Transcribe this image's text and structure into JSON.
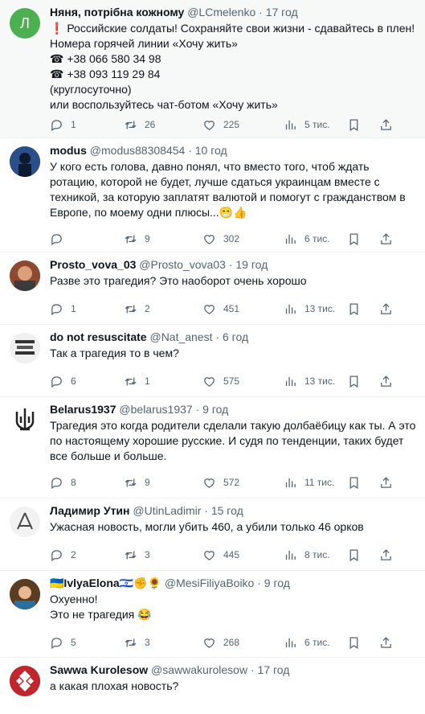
{
  "tweets": [
    {
      "name": "Няня, потрібна кожному",
      "handle": "@LCmelenko",
      "time": "17 год",
      "text": "❗ Российские солдаты! Сохраняйте свои жизни - сдавайтесь в плен!\nНомера горячей линии «Хочу жить»\n☎ +38 066 580 34 98\n☎ +38 093 119 29 84\n(круглосуточно)\nили воспользуйтесь чат-ботом «Хочу жить»",
      "replies": "1",
      "retweets": "26",
      "likes": "225",
      "views": "5 тис.",
      "avatar_letter": "Л",
      "avatar_color": "#4caf50"
    },
    {
      "name": "modus",
      "handle": "@modus88308454",
      "time": "10 год",
      "text": "У кого есть голова, давно понял, что вместо того, чтоб ждать ротацию, которой не будет, лучше сдаться украинцам вместе с техникой, за которую заплатят валютой и помогут с гражданством в Европе, по моему одни плюсы...😁👍",
      "replies": "",
      "retweets": "9",
      "likes": "302",
      "views": "6 тис.",
      "avatar_color": "#1f3a66"
    },
    {
      "name": "Prosto_vova_03",
      "handle": "@Prosto_vova03",
      "time": "19 год",
      "text": "Разве это трагедия? Это наоборот очень хорошо",
      "replies": "1",
      "retweets": "2",
      "likes": "451",
      "views": "13 тис.",
      "avatar_color": "#a55a3a"
    },
    {
      "name": "do not resuscitate",
      "handle": "@Nat_anest",
      "time": "6 год",
      "text": "Так а трагедия то в чем?",
      "replies": "6",
      "retweets": "1",
      "likes": "575",
      "views": "13 тис.",
      "avatar_color": "#e8e8e8"
    },
    {
      "name": "Belarus1937",
      "handle": "@belarus1937",
      "time": "9 год",
      "text": "Трагедия это когда родители сделали такую долбаёбицу как ты. А это по настоящему хорошие русские. И судя по тенденции, таких будет все больше и больше.",
      "replies": "8",
      "retweets": "9",
      "likes": "572",
      "views": "11 тис.",
      "avatar_color": "#ffffff"
    },
    {
      "name": "Ладимир Утин",
      "handle": "@UtinLadimir",
      "time": "15 год",
      "text": "Ужасная новость, могли убить 460, а убили только 46 орков",
      "replies": "2",
      "retweets": "3",
      "likes": "445",
      "views": "8 тис.",
      "avatar_color": "#f2f2f2"
    },
    {
      "name": "🇺🇦IvlyaElona🇮🇱✊🌻",
      "handle": "@MesiFiliyaBoiko",
      "time": "9 год",
      "text": "Охуенно!\nЭто не трагедия 😂",
      "replies": "5",
      "retweets": "3",
      "likes": "268",
      "views": "6 тис.",
      "avatar_color": "#6b4a2e"
    },
    {
      "name": "Sawwa Kurolesow",
      "handle": "@sawwakurolesow",
      "time": "17 год",
      "text": "а какая плохая новость?",
      "replies": "",
      "retweets": "",
      "likes": "",
      "views": "",
      "avatar_color": "#c0272d"
    }
  ],
  "colors": {
    "text": "#0f1419",
    "muted": "#536471",
    "divider": "#eff3f4"
  },
  "icons": [
    "reply-icon",
    "retweet-icon",
    "like-icon",
    "views-icon",
    "bookmark-icon",
    "share-icon"
  ]
}
